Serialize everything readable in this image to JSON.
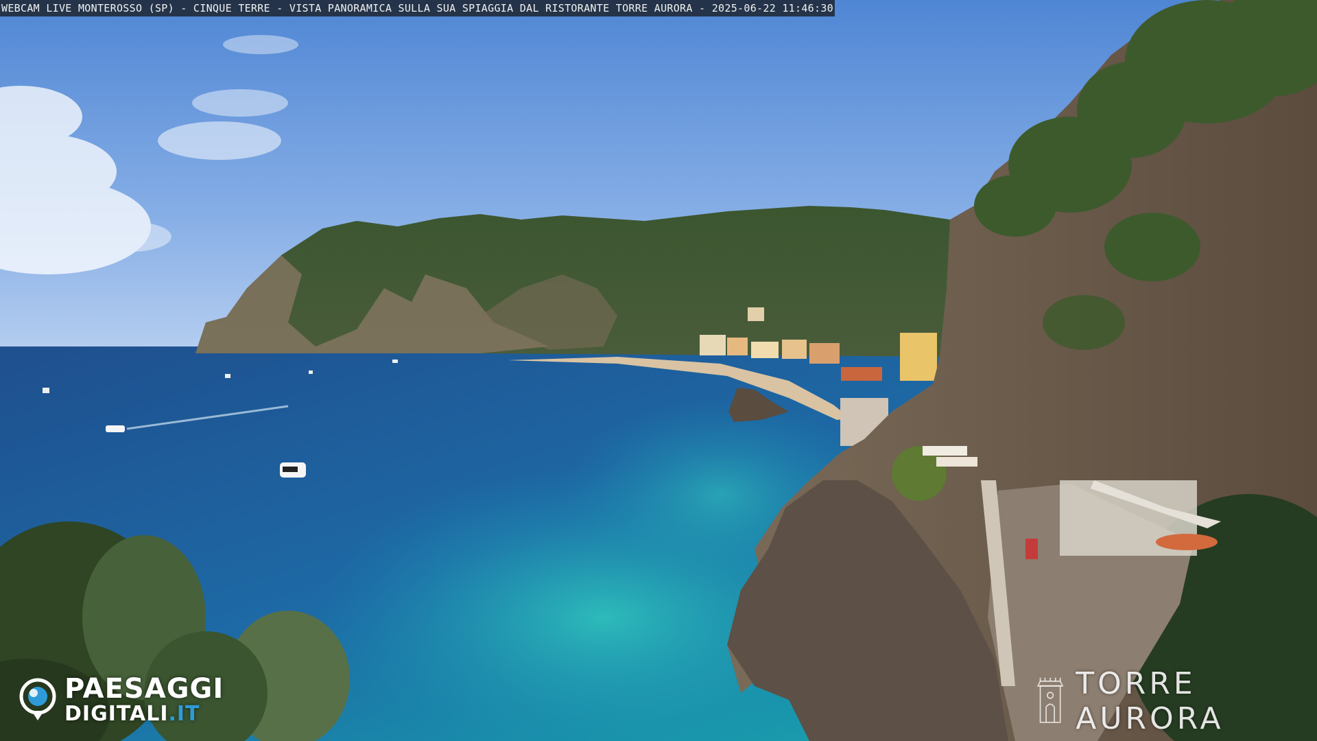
{
  "caption": {
    "text": "WEBCAM LIVE MONTEROSSO (SP) - CINQUE TERRE - VISTA PANORAMICA SULLA SUA SPIAGGIA DAL RISTORANTE TORRE AURORA - 2025-06-22 11:46:30"
  },
  "logo": {
    "line1": "PAESAGGI",
    "line2_main": "DIGITALI",
    "line2_accent": ".IT"
  },
  "brand": {
    "text": "TORRE AURORA"
  },
  "colors": {
    "sky_top": "#5b8fd6",
    "sky_horizon": "#a9c6ec",
    "sea_deep": "#1f5a9a",
    "sea_turquoise": "#1aa2b0",
    "hill_green": "#3e5a2e",
    "rock": "#6f5e4e",
    "logo_accent": "#2e9bd8"
  }
}
